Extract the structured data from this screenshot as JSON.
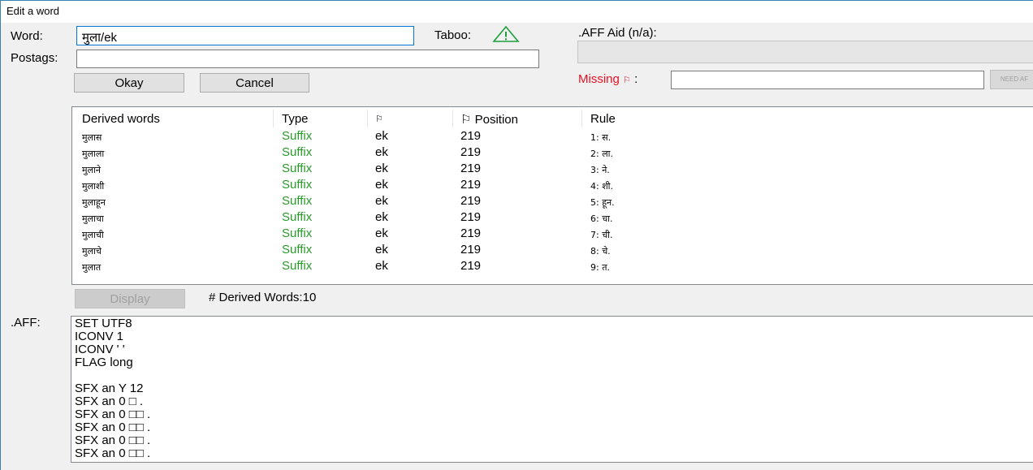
{
  "window": {
    "title": "Edit a word"
  },
  "form": {
    "word_label": "Word:",
    "word_value": "मुला/ek",
    "postags_label": "Postags:",
    "postags_value": "",
    "taboo_label": "Taboo:",
    "okay_label": "Okay",
    "cancel_label": "Cancel"
  },
  "aff_aid": {
    "label": ".AFF Aid (n/a):",
    "value": "",
    "missing_label": "Missing",
    "missing_flag": "⚐",
    "missing_colon": ":",
    "missing_value": "",
    "need_button": "NEED AF"
  },
  "table": {
    "headers": {
      "derived": "Derived words",
      "type": "Type",
      "flag": "⚐",
      "position": "⚐ Position",
      "rule": "Rule"
    },
    "rows": [
      {
        "word": "मुलास",
        "type": "Suffix",
        "flag": "ek",
        "position": "219",
        "rule": "1: स."
      },
      {
        "word": "मुलाला",
        "type": "Suffix",
        "flag": "ek",
        "position": "219",
        "rule": "2: ला."
      },
      {
        "word": "मुलाने",
        "type": "Suffix",
        "flag": "ek",
        "position": "219",
        "rule": "3: ने."
      },
      {
        "word": "मुलाशी",
        "type": "Suffix",
        "flag": "ek",
        "position": "219",
        "rule": "4: शी."
      },
      {
        "word": "मुलाहून",
        "type": "Suffix",
        "flag": "ek",
        "position": "219",
        "rule": "5: हून."
      },
      {
        "word": "मुलाचा",
        "type": "Suffix",
        "flag": "ek",
        "position": "219",
        "rule": "6: चा."
      },
      {
        "word": "मुलाची",
        "type": "Suffix",
        "flag": "ek",
        "position": "219",
        "rule": "7: ची."
      },
      {
        "word": "मुलाचे",
        "type": "Suffix",
        "flag": "ek",
        "position": "219",
        "rule": "8: चे."
      },
      {
        "word": "मुलात",
        "type": "Suffix",
        "flag": "ek",
        "position": "219",
        "rule": "9: त."
      }
    ]
  },
  "display": {
    "button_label": "Display",
    "count_text": "# Derived Words:10"
  },
  "aff": {
    "label": ".AFF:",
    "lines": [
      "SET UTF8",
      "ICONV 1",
      "ICONV ' '",
      "FLAG long",
      "",
      "SFX an Y 12",
      "SFX an 0 □ .",
      "SFX an 0 □□ .",
      "SFX an 0 □□ .",
      "SFX an 0 □□ .",
      "SFX an 0 □□ ."
    ]
  },
  "colors": {
    "suffix": "#2a9a2a",
    "missing": "#e81123",
    "focus": "#0078d7",
    "warning_icon": "#1e9e3e"
  }
}
